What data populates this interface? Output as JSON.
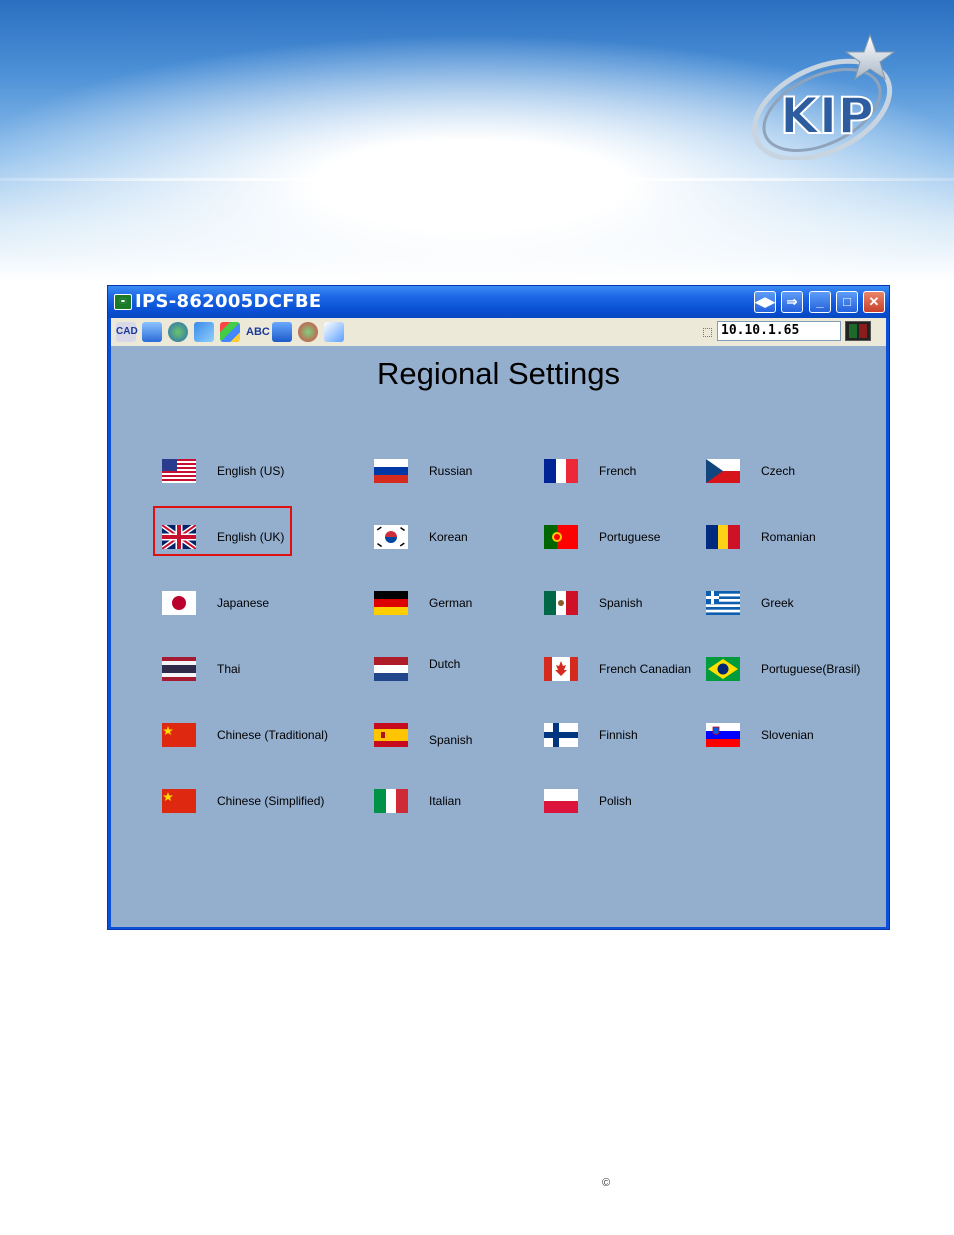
{
  "window": {
    "title": "IPS-862005DCFBE",
    "ip_address": "10.10.1.65"
  },
  "page": {
    "heading": "Regional Settings",
    "selected_language": "English (US)"
  },
  "languages": [
    {
      "label": "English (US)",
      "flag": "us-flag"
    },
    {
      "label": "English (UK)",
      "flag": "uk-flag"
    },
    {
      "label": "Japanese",
      "flag": "japan-flag"
    },
    {
      "label": "Thai",
      "flag": "thailand-flag"
    },
    {
      "label": "Chinese (Traditional)",
      "flag": "china-flag"
    },
    {
      "label": "Chinese (Simplified)",
      "flag": "china-flag"
    },
    {
      "label": "Russian",
      "flag": "russia-flag"
    },
    {
      "label": "Korean",
      "flag": "korea-flag"
    },
    {
      "label": "German",
      "flag": "germany-flag"
    },
    {
      "label": "Dutch",
      "flag": "netherlands-flag"
    },
    {
      "label": "Spanish",
      "flag": "spain-flag"
    },
    {
      "label": "Italian",
      "flag": "italy-flag"
    },
    {
      "label": "French",
      "flag": "france-flag"
    },
    {
      "label": "Portuguese",
      "flag": "portugal-flag"
    },
    {
      "label": "Spanish",
      "flag": "mexico-flag"
    },
    {
      "label": "French Canadian",
      "flag": "canada-flag"
    },
    {
      "label": "Finnish",
      "flag": "finland-flag"
    },
    {
      "label": "Polish",
      "flag": "poland-flag"
    },
    {
      "label": "Czech",
      "flag": "czech-flag"
    },
    {
      "label": "Romanian",
      "flag": "romania-flag"
    },
    {
      "label": "Greek",
      "flag": "greece-flag"
    },
    {
      "label": "Portuguese(Brasil)",
      "flag": "brazil-flag"
    },
    {
      "label": "Slovenian",
      "flag": "slovenia-flag"
    }
  ],
  "footer": {
    "copyright": "©"
  },
  "colors": {
    "content_bg": "#94aece",
    "titlebar": "#0a52d6",
    "selection_border": "#e01010"
  }
}
